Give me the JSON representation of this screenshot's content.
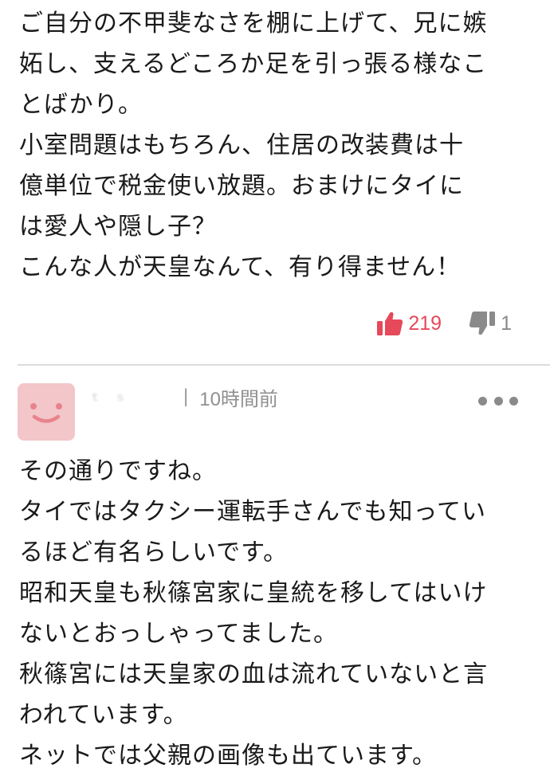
{
  "previous_comment": {
    "lines": [
      "ご自分の不甲斐なさを棚に上げて、兄に嫉",
      "妬し、支えるどころか足を引っ張る様なこ",
      "とばかり。",
      "小室問題はもちろん、住居の改装費は十",
      "億単位で税金使い放題。おまけにタイに",
      "は愛人や隠し子？",
      "こんな人が天皇なんて、有り得ません！"
    ],
    "likes": "219",
    "dislikes": "1"
  },
  "reply": {
    "username": "ｔ　ｓ",
    "separator": "|",
    "time": "10時間前",
    "lines": [
      "その通りですね。",
      "タイではタクシー運転手さんでも知ってい",
      "るほど有名らしいです。",
      "昭和天皇も秋篠宮家に皇統を移してはいけ",
      "ないとおっしゃってました。",
      "秋篠宮には天皇家の血は流れていないと言",
      "われています。",
      "ネットでは父親の画像も出ています。"
    ]
  },
  "colors": {
    "like": "#e6495a",
    "dislike": "#8a8a8a",
    "avatar_bg": "#f3c6c9",
    "avatar_face": "#e8838c",
    "meta_text": "#8f8f8f",
    "divider": "#dcdcdc"
  },
  "icons": {
    "like": "thumbs-up-icon",
    "dislike": "thumbs-down-icon",
    "more": "more-dots-icon",
    "avatar": "smiley-face-avatar"
  }
}
